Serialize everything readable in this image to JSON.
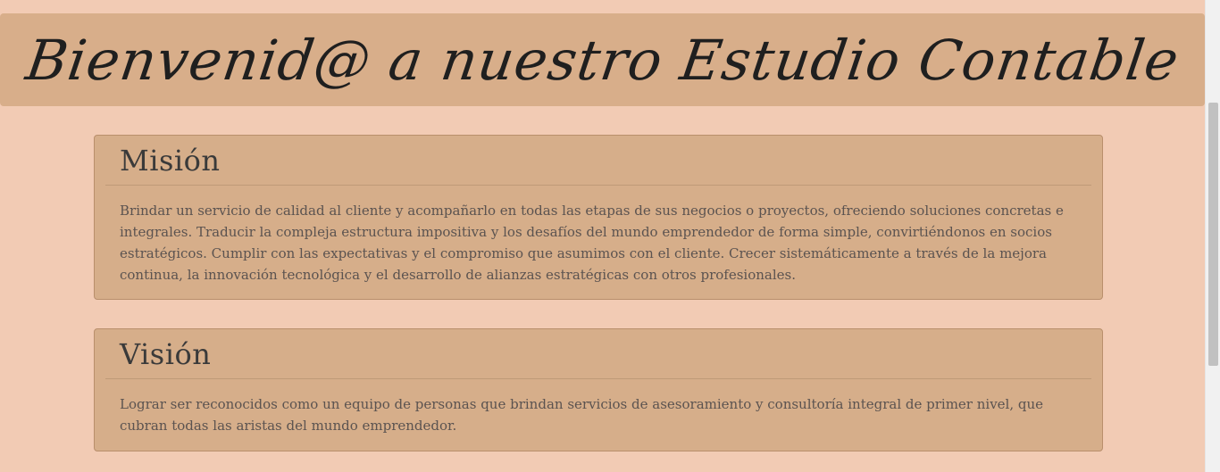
{
  "header": {
    "title": "Bienvenid@ a nuestro Estudio Contable"
  },
  "mision": {
    "title": "Misión",
    "text": "Brindar un servicio de calidad al cliente y acompañarlo en todas las etapas de sus negocios o proyectos, ofreciendo soluciones concretas e integrales. Traducir la compleja estructura impositiva y los desafíos del mundo emprendedor de forma simple, convirtiéndonos en socios estratégicos. Cumplir con las expectativas y el compromiso que asumimos con el cliente. Crecer sistemáticamente a través de la mejora continua, la innovación tecnológica y el desarrollo de alianzas estratégicas con otros profesionales."
  },
  "vision": {
    "title": "Visión",
    "text": "Lograr ser reconocidos como un equipo de personas que brindan servicios de asesoramiento y consultoría integral de primer nivel, que cubran todas las aristas del mundo emprendedor."
  },
  "colors": {
    "page_background": "#f2cbb4",
    "header_background": "#d8ae8a",
    "card_background": "#d6ae8a",
    "text": "#5b5350"
  }
}
